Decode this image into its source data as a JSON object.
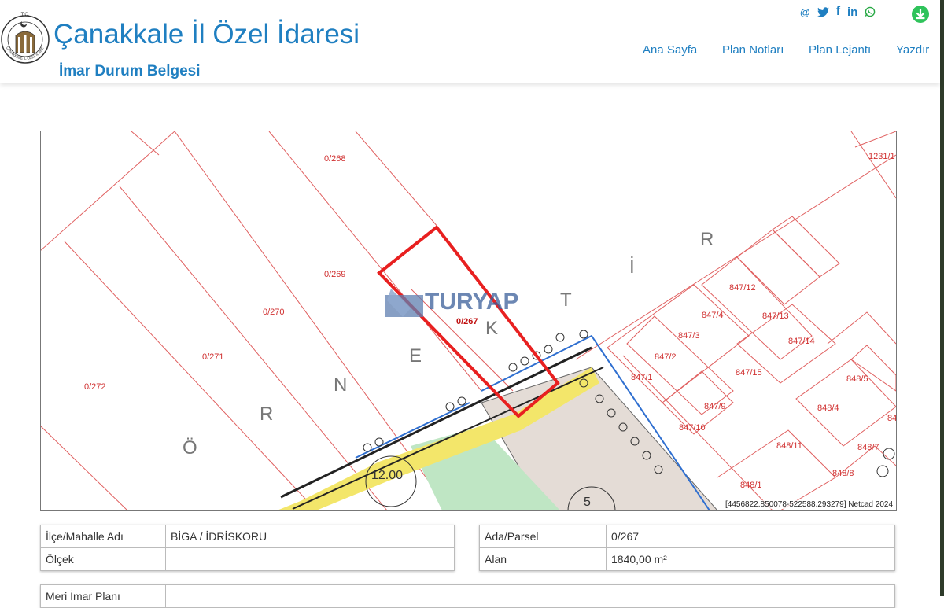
{
  "header": {
    "title": "Çanakkale İl Özel İdaresi",
    "subtitle": "İmar Durum Belgesi",
    "logo": {
      "top_text": "T.C.",
      "ring_text": "ÇANAKKALE İL ÖZEL İDARESİ"
    },
    "social": [
      "@",
      "twitter-icon",
      "f",
      "in",
      "whatsapp-icon"
    ],
    "nav": [
      "Ana Sayfa",
      "Plan Notları",
      "Plan Lejantı",
      "Yazdır"
    ]
  },
  "map": {
    "parcel_labels": [
      "0/268",
      "0/269",
      "0/270",
      "0/271",
      "0/272",
      "0/267",
      "1231/1",
      "847/12",
      "847/4",
      "847/13",
      "847/3",
      "847/14",
      "847/2",
      "847/15",
      "847/1",
      "848/5",
      "847/9",
      "848/4",
      "847/10",
      "848/11",
      "848/7",
      "848/8",
      "848/1",
      "84"
    ],
    "street_letters": [
      "Ö",
      "R",
      "N",
      "E",
      "K",
      "T",
      "İ",
      "R"
    ],
    "road_label": "12.00",
    "block_label": "5",
    "watermark": "TURYAP",
    "coords": "[4456822.850078-522588.293279] Netcad 2024"
  },
  "info_left": [
    {
      "label": "İlçe/Mahalle Adı",
      "value": "BİGA / İDRİSKORU"
    },
    {
      "label": "Ölçek",
      "value": ""
    }
  ],
  "info_right": [
    {
      "label": "Ada/Parsel",
      "value": "0/267"
    },
    {
      "label": "Alan",
      "value": "1840,00 m²"
    }
  ],
  "info_bottom": [
    {
      "label": "Meri İmar Planı",
      "value": ""
    }
  ],
  "colors": {
    "brand_blue": "#1f7fc1",
    "parcel_line": "#e06060",
    "selected_parcel": "#e82020",
    "download_green": "#2fc35b"
  }
}
